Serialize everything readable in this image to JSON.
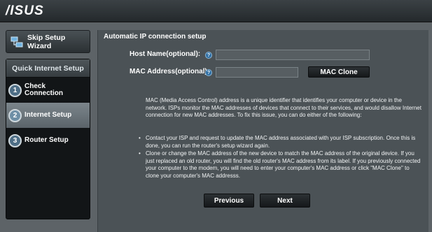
{
  "header": {
    "logo": "/ISUS"
  },
  "sidebar": {
    "skip_label": "Skip Setup Wizard",
    "qis_title": "Quick Internet Setup",
    "steps": [
      {
        "num": "1",
        "label": "Check Connection"
      },
      {
        "num": "2",
        "label": "Internet Setup"
      },
      {
        "num": "3",
        "label": "Router Setup"
      }
    ]
  },
  "content": {
    "section_title": "Automatic IP connection setup",
    "host_name_label": "Host Name(optional):",
    "host_name_value": "",
    "mac_label": "MAC Address(optional)",
    "mac_value": "",
    "help_glyph": "?",
    "mac_clone_label": "MAC Clone",
    "description": "MAC (Media Access Control) address is a unique identifier that identifies your computer or device in the network. ISPs monitor the MAC addresses of devices that connect to their services, and would disallow Internet connection for new MAC addresses. To fix this issue, you can do either of the following:",
    "bullets": [
      "Contact your ISP and request to update the MAC address associated with your ISP subscription. Once this is done, you can run the router's setup wizard again.",
      "Clone or change the MAC address of the new device to match the MAC address of the original device. If you just replaced an old router, you will find the old router's MAC address from its label. If you previously connected your computer to the modem, you will need to enter your computer's MAC address or click \"MAC Clone\" to clone your computer's MAC addresss."
    ],
    "previous_label": "Previous",
    "next_label": "Next"
  }
}
